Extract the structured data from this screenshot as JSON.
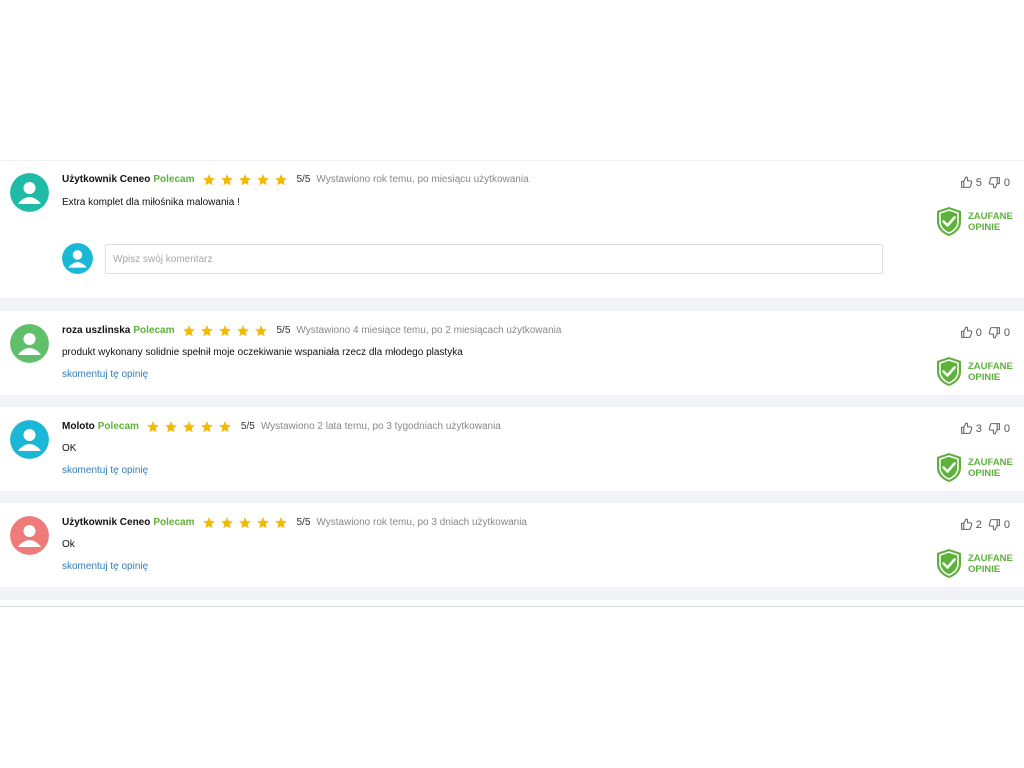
{
  "recommend_label": "Polecam",
  "comment_link_label": "skomentuj tę opinię",
  "comment_placeholder": "Wpisz swój komentarz",
  "badge": {
    "line1": "ZAUFANE",
    "line2": "OPINIE",
    "color": "#5fb13b"
  },
  "star_color": "#f5b800",
  "reviews": [
    {
      "author": "Użytkownik Ceneo",
      "rating": 5,
      "score": "5/5",
      "posted": "Wystawiono rok temu, po miesiącu użytkowania",
      "text": "Extra komplet dla miłośnika malowania !",
      "likes": "5",
      "dislikes": "0",
      "avatar_color": "#1fbba6"
    },
    {
      "author": "roza uszlinska",
      "rating": 5,
      "score": "5/5",
      "posted": "Wystawiono 4 miesiące temu, po 2 miesiącach użytkowania",
      "text": "produkt wykonany solidnie spełnił moje oczekiwanie wspaniała rzecz dla młodego plastyka",
      "likes": "0",
      "dislikes": "0",
      "avatar_color": "#5fbf6b"
    },
    {
      "author": "Moloto",
      "rating": 5,
      "score": "5/5",
      "posted": "Wystawiono 2 lata temu, po 3 tygodniach użytkowania",
      "text": "OK",
      "likes": "3",
      "dislikes": "0",
      "avatar_color": "#1ab8d6"
    },
    {
      "author": "Użytkownik Ceneo",
      "rating": 5,
      "score": "5/5",
      "posted": "Wystawiono rok temu, po 3 dniach użytkowania",
      "text": "Ok",
      "likes": "2",
      "dislikes": "0",
      "avatar_color": "#ef7a7a"
    }
  ],
  "commenter_avatar_color": "#1ab8d6"
}
